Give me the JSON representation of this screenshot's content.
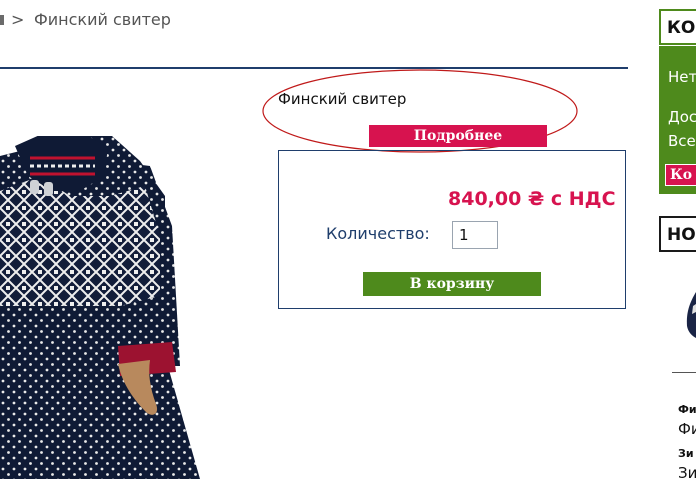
{
  "breadcrumb": {
    "separator": ">",
    "current": "Финский свитер"
  },
  "product": {
    "title": "Финский свитер",
    "details_button": "Подробнее",
    "price": "840,00 ₴ с НДС",
    "quantity_label": "Количество:",
    "quantity_value": "1",
    "add_to_cart_button": "В корзину"
  },
  "sidebar": {
    "cart": {
      "heading": "КО",
      "line1": "Нет",
      "line2": "Дос",
      "line3": "Все",
      "button": "Ко"
    },
    "new_items": {
      "heading": "НО",
      "items": [
        {
          "category": "Фи",
          "name": "Фи"
        },
        {
          "category": "Зи",
          "name": "Зи"
        }
      ]
    }
  },
  "colors": {
    "accent_red": "#d7134f",
    "accent_green": "#4e8a1c",
    "navy": "#1f3e6c"
  }
}
